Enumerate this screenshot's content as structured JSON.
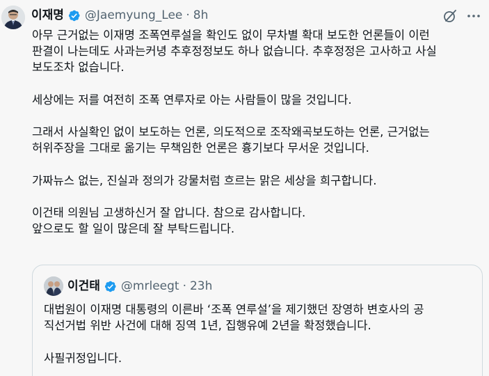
{
  "tweet": {
    "author_name": "이재명",
    "handle": "@Jaemyung_Lee",
    "separator": "·",
    "time": "8h",
    "paragraphs": [
      "아무 근거없는 이재명 조폭연루설을 확인도 없이 무차별 확대 보도한 언론들이 이런\n판결이 나는데도 사과는커녕 추후정정보도 하나 없습니다. 추후정정은 고사하고 사실\n보도조차 없습니다.",
      "세상에는 저를 여전히 조폭 연루자로 아는 사람들이 많을 것입니다.",
      "그래서 사실확인 없이 보도하는 언론, 의도적으로 조작왜곡보도하는 언론, 근거없는\n허위주장을 그대로 옮기는 무책임한 언론은 흉기보다 무서운 것입니다.",
      "가짜뉴스 없는, 진실과 정의가 강물처럼 흐르는 맑은 세상을 희구합니다.",
      "이건태 의원님 고생하신거 잘 압니다. 참으로 감사합니다.\n앞으로도 할 일이 많은데 잘 부탁드립니다."
    ]
  },
  "quoted_tweet": {
    "author_name": "이건태",
    "handle": "@mrleegt",
    "separator": "·",
    "time": "23h",
    "paragraphs": [
      "대법원이 이재명 대통령의 이른바 ‘조폭 연루설’을 제기했던 장영하 변호사의 공\n직선거법 위반 사건에 대해 징역 1년, 집행유예 2년을 확정했습니다.",
      "사필귀정입니다."
    ]
  },
  "icons": {
    "verified": "verified-badge-icon",
    "grok": "grok-icon",
    "more": "more-icon"
  },
  "colors": {
    "verified_blue": "#1d9bf0",
    "secondary_text": "#536471",
    "border": "#cfd9de",
    "background": "#f7f7f7"
  }
}
